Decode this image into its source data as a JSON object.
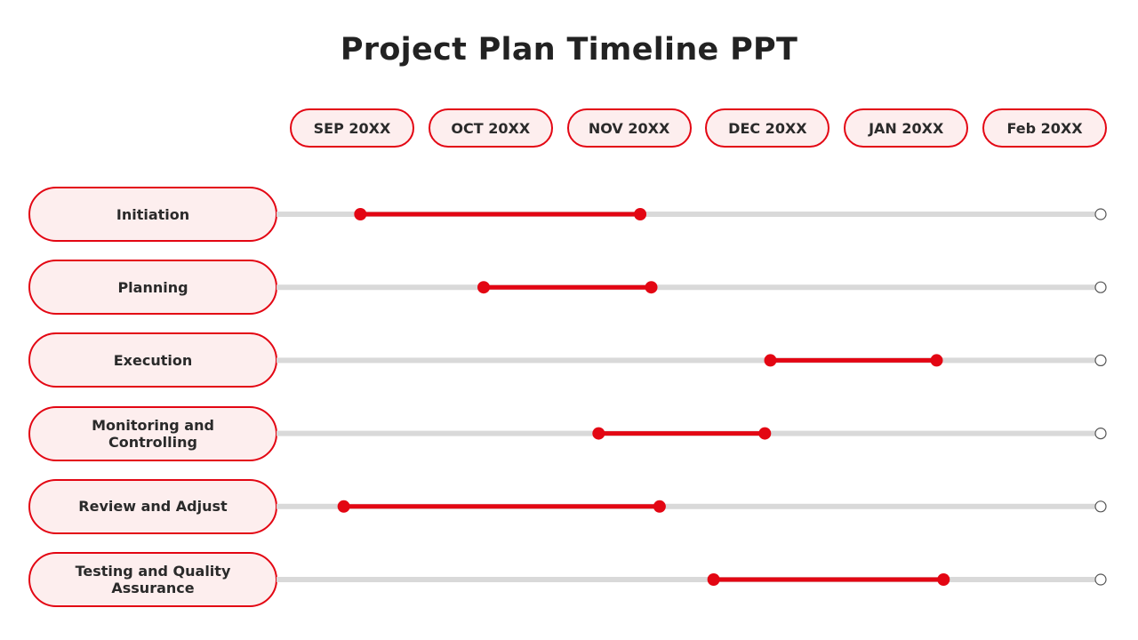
{
  "title": "Project Plan Timeline PPT",
  "colors": {
    "accent": "#e30613",
    "pill_fill": "#fdeeee",
    "track": "#d9d9d9",
    "text": "#2a2a2a"
  },
  "chart_data": {
    "type": "gantt",
    "title": "Project Plan Timeline PPT",
    "months": [
      "SEP 20XX",
      "OCT 20XX",
      "NOV 20XX",
      "DEC 20XX",
      "JAN 20XX",
      "Feb 20XX"
    ],
    "axis_unit": "month index (0 = SEP 20XX center, 5 = Feb 20XX center)",
    "tasks": [
      {
        "name": "Initiation",
        "start": 0.06,
        "end": 2.08
      },
      {
        "name": "Planning",
        "start": 0.95,
        "end": 2.16
      },
      {
        "name": "Execution",
        "start": 3.02,
        "end": 4.22
      },
      {
        "name": "Monitoring and Controlling",
        "start": 1.78,
        "end": 2.98
      },
      {
        "name": "Review and Adjust",
        "start": -0.06,
        "end": 2.22
      },
      {
        "name": "Testing and Quality Assurance",
        "start": 2.61,
        "end": 4.27
      }
    ],
    "track_end_marker": "open-circle"
  }
}
